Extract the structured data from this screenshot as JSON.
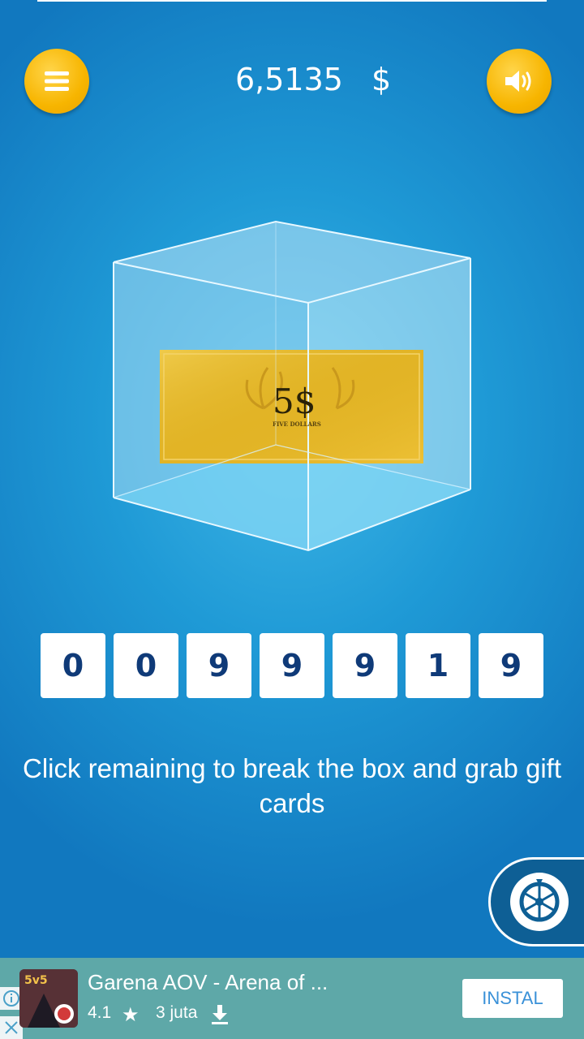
{
  "header": {
    "balance": "6,5135",
    "currency": "$"
  },
  "prize": {
    "note_value": "5$",
    "note_caption": "FIVE DOLLARS"
  },
  "counter": {
    "digits": [
      "0",
      "0",
      "9",
      "9",
      "9",
      "1",
      "9"
    ]
  },
  "instruction": "Click remaining to break the box and grab gift cards",
  "ad": {
    "icon_text": "5v5",
    "title": "Garena AOV - Arena of ...",
    "rating": "4.1",
    "downloads": "3 juta",
    "install_label": "INSTAL"
  },
  "icons": {
    "menu": "hamburger-menu-icon",
    "sound": "speaker-icon",
    "wheel": "lucky-wheel-icon",
    "star": "star-icon",
    "download": "download-icon",
    "info": "info-icon",
    "close": "close-icon"
  },
  "colors": {
    "accent_yellow": "#f7b500",
    "background_blue": "#1f9ad6",
    "digit_text": "#0f3a78",
    "ad_bar": "#5ea8a8",
    "install_text": "#3a91d8"
  }
}
